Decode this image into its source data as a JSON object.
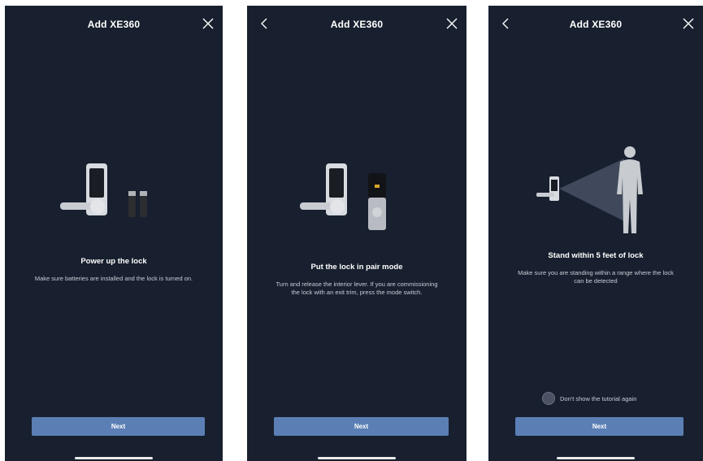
{
  "screens": [
    {
      "title": "Add XE360",
      "show_back": false,
      "heading": "Power up the lock",
      "description": "Make sure batteries are installed and the lock is turned on.",
      "next_label": "Next",
      "icons": {
        "close": "close-icon",
        "illustration": "lock-with-batteries-illustration"
      }
    },
    {
      "title": "Add XE360",
      "show_back": true,
      "heading": "Put the lock in pair mode",
      "description": "Turn and release the interior lever. If you are commissioning the lock with an exit trim, press the mode switch.",
      "next_label": "Next",
      "icons": {
        "back": "chevron-left-icon",
        "close": "close-icon",
        "illustration": "lock-with-exit-trim-illustration"
      }
    },
    {
      "title": "Add XE360",
      "show_back": true,
      "heading": "Stand within 5 feet of lock",
      "description": "Make sure you are standing within a range where the lock can be detected",
      "checkbox_label": "Don't show the tutorial again",
      "checkbox_checked": false,
      "next_label": "Next",
      "icons": {
        "back": "chevron-left-icon",
        "close": "close-icon",
        "illustration": "person-near-lock-illustration"
      }
    }
  ],
  "colors": {
    "background": "#18202f",
    "button": "#5b7fb5",
    "text": "#ffffff",
    "secondary_text": "#c7ccd6"
  }
}
